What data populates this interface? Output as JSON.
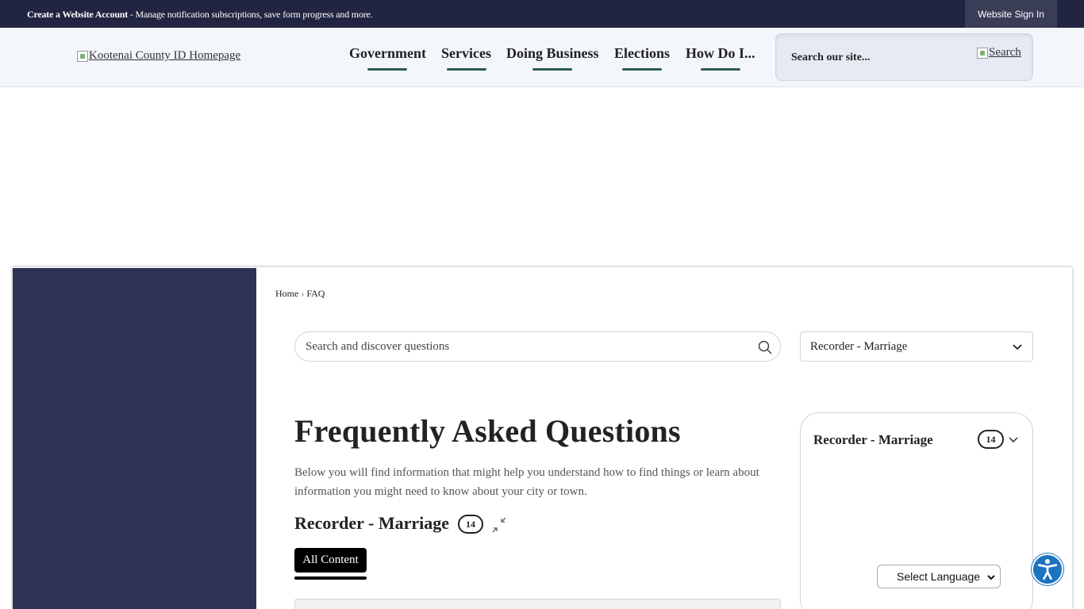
{
  "topbar": {
    "create_account": "Create a Website Account",
    "message": " - Manage notification subscriptions, save form progress and more.",
    "sign_in": "Website Sign In"
  },
  "header": {
    "logo_alt": "Kootenai County ID Homepage",
    "nav": [
      "Government",
      "Services",
      "Doing Business",
      "Elections",
      "How Do I..."
    ],
    "search_placeholder": "Search our site...",
    "search_button_alt": "Search"
  },
  "breadcrumb": {
    "home": "Home",
    "separator": "›",
    "current": "FAQ"
  },
  "faq": {
    "search_placeholder": "Search and discover questions",
    "category_select": "Recorder - Marriage",
    "title": "Frequently Asked Questions",
    "intro": "Below you will find information that might help you understand how to find things or learn about information you might need to know about your city or town.",
    "category_heading": "Recorder - Marriage",
    "category_count": "14",
    "tab_all": "All Content"
  },
  "side_card": {
    "title": "Recorder - Marriage",
    "count": "14"
  },
  "language": {
    "label": "Select Language"
  },
  "colors": {
    "topbar": "#222542",
    "sidebar": "#2e3456",
    "nav_underline": "#2e5d4d",
    "accessibility": "#1e73be"
  },
  "icons": [
    "search-icon",
    "chevron-down-icon",
    "collapse-icon",
    "accessibility-icon",
    "broken-image-icon"
  ]
}
